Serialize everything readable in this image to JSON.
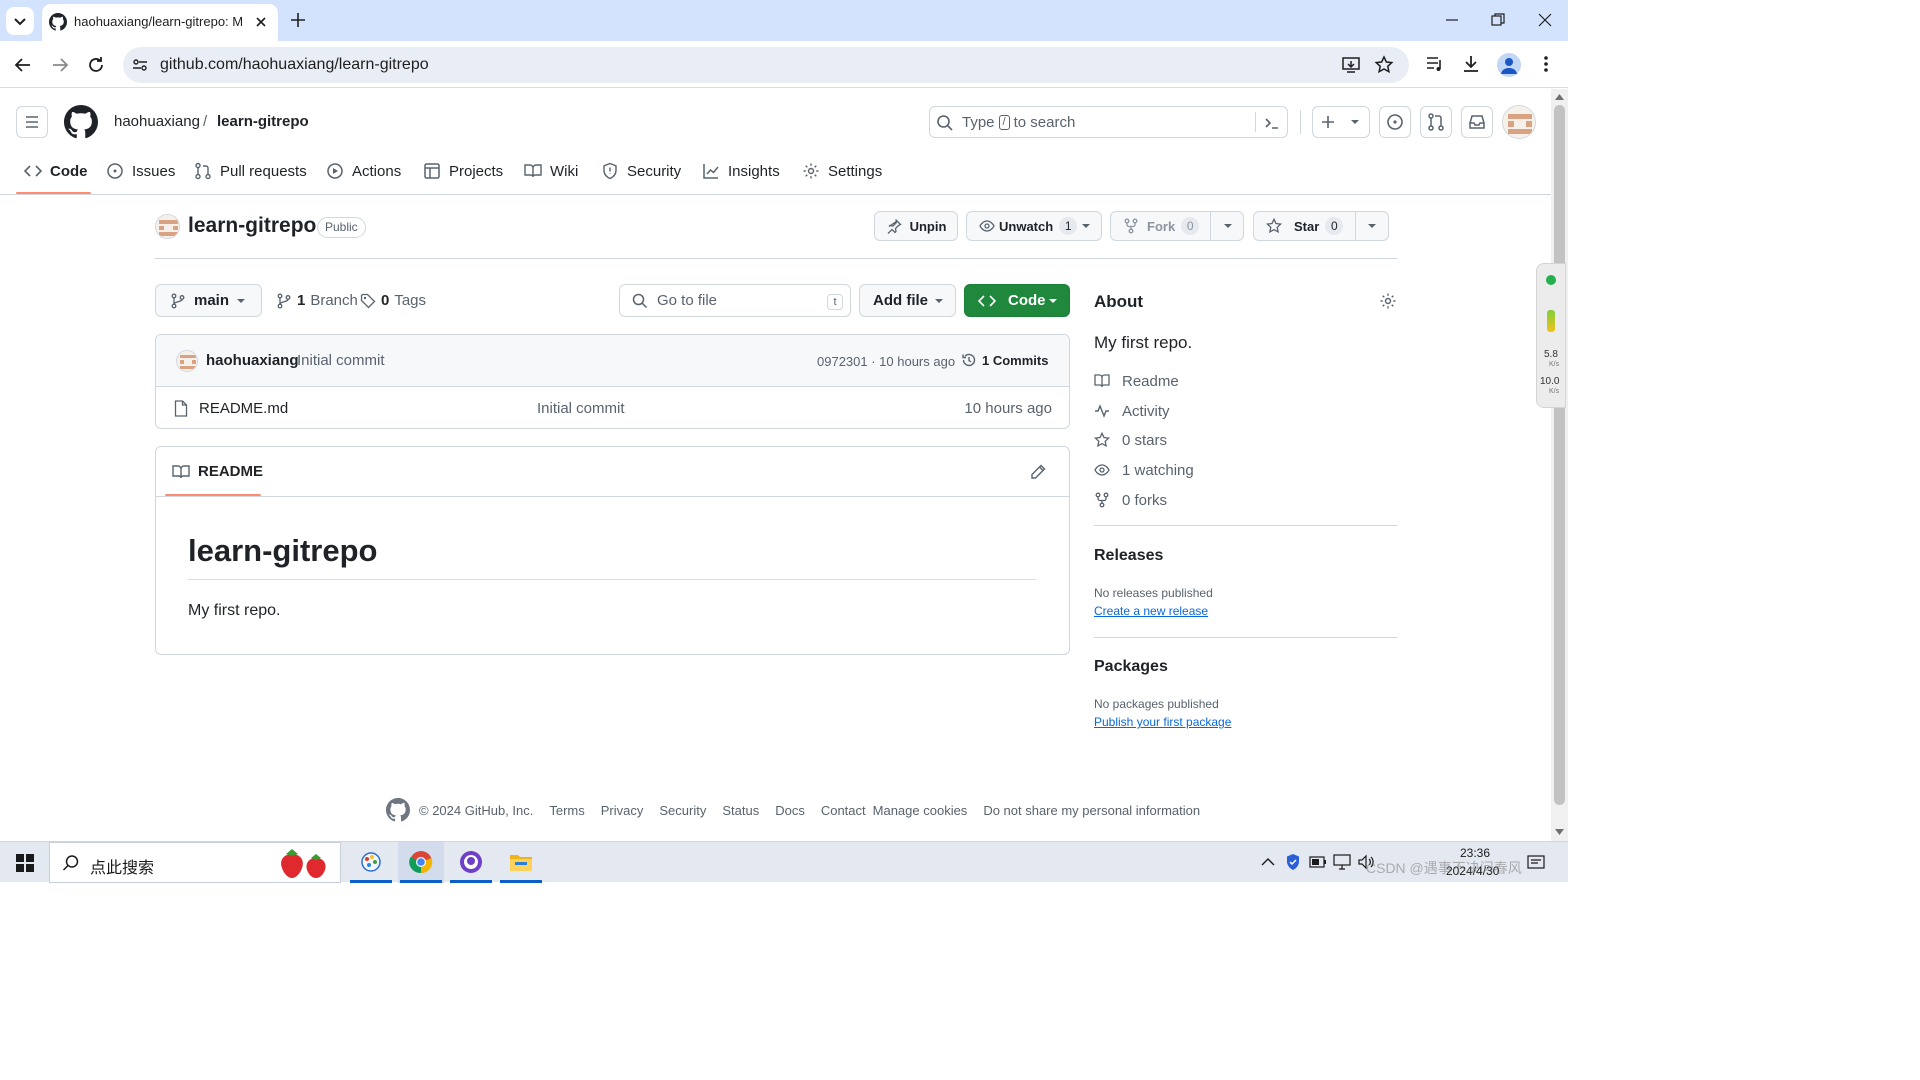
{
  "browser": {
    "tab_title": "haohuaxiang/learn-gitrepo: M",
    "address": "github.com/haohuaxiang/learn-gitrepo"
  },
  "header": {
    "owner": "haohuaxiang",
    "separator": "/",
    "repo": "learn-gitrepo",
    "search_prefix": "Type",
    "search_key": "/",
    "search_suffix": "to search"
  },
  "nav": [
    {
      "label": "Code"
    },
    {
      "label": "Issues"
    },
    {
      "label": "Pull requests"
    },
    {
      "label": "Actions"
    },
    {
      "label": "Projects"
    },
    {
      "label": "Wiki"
    },
    {
      "label": "Security"
    },
    {
      "label": "Insights"
    },
    {
      "label": "Settings"
    }
  ],
  "repo": {
    "name": "learn-gitrepo",
    "visibility": "Public",
    "unpin": "Unpin",
    "unwatch": "Unwatch",
    "watch_count": "1",
    "fork": "Fork",
    "fork_count": "0",
    "star": "Star",
    "star_count": "0"
  },
  "filebar": {
    "branch": "main",
    "branch_count": "1",
    "branch_label": "Branch",
    "tag_count": "0",
    "tag_label": "Tags",
    "goto_placeholder": "Go to file",
    "goto_key": "t",
    "add_file": "Add file",
    "code": "Code"
  },
  "commit": {
    "author": "haohuaxiang",
    "message": "Initial commit",
    "hash_time": "0972301 · 10 hours ago",
    "commits": "1 Commits"
  },
  "files": [
    {
      "name": "README.md",
      "message": "Initial commit",
      "time": "10 hours ago"
    }
  ],
  "readme": {
    "tab": "README",
    "heading": "learn-gitrepo",
    "body": "My first repo."
  },
  "about": {
    "title": "About",
    "description": "My first repo.",
    "links": [
      {
        "icon": "book-icon",
        "label": "Readme"
      },
      {
        "icon": "pulse-icon",
        "label": "Activity"
      },
      {
        "icon": "star-icon",
        "label": "0 stars"
      },
      {
        "icon": "eye-icon",
        "label": "1 watching"
      },
      {
        "icon": "fork-icon",
        "label": "0 forks"
      }
    ]
  },
  "releases": {
    "title": "Releases",
    "empty": "No releases published",
    "link": "Create a new release"
  },
  "packages": {
    "title": "Packages",
    "empty": "No packages published",
    "link": "Publish your first package"
  },
  "footer": {
    "copyright": "© 2024 GitHub, Inc.",
    "links": [
      "Terms",
      "Privacy",
      "Security",
      "Status",
      "Docs",
      "Contact",
      "Manage cookies",
      "Do not share my personal information"
    ]
  },
  "speed_widget": {
    "up": "5.8",
    "up_unit": "K/s",
    "down": "10.0",
    "down_unit": "K/s"
  },
  "taskbar": {
    "search_placeholder": "点此搜索",
    "time": "23:36",
    "date": "2024/4/30",
    "watermark": "CSDN @遇事不决问春风"
  },
  "colors": {
    "accent_green": "#1f883d",
    "link_blue": "#0969da",
    "nav_underline": "#fd8c73",
    "chrome_tabstrip": "#d3e3fd"
  }
}
